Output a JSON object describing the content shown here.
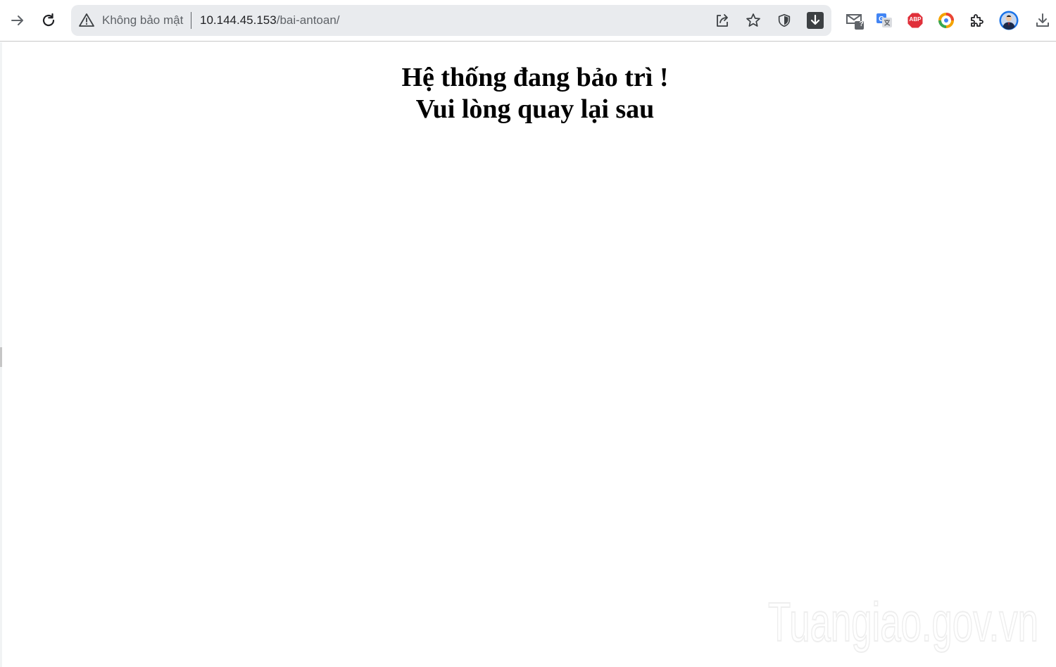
{
  "browser": {
    "omnibox": {
      "security_label": "Không bảo mật",
      "url_host": "10.144.45.153",
      "url_path": "/bai-antoan/"
    },
    "icons": {
      "forward": "arrow-right-icon",
      "reload": "reload-icon",
      "warning": "warning-triangle-icon",
      "share": "share-icon",
      "bookmark": "star-icon",
      "shield": "shield-icon",
      "download_ext": "download-arrow-icon",
      "mail_checker": "mail-icon",
      "translate": "google-translate-icon",
      "adblock": "adblock-plus-icon",
      "colorful_ext": "circle-extension-icon",
      "extensions": "puzzle-icon",
      "profile": "avatar-icon",
      "downloads": "downloads-icon"
    },
    "badges": {
      "mail_badge": "?",
      "adblock_label": "ABP"
    }
  },
  "page": {
    "heading_line1": "Hệ thống đang bảo trì !",
    "heading_line2": "Vui lòng quay lại sau"
  },
  "watermark": {
    "text": "Tuangiao.gov.vn"
  },
  "colors": {
    "omnibox_bg": "#e9ebee",
    "icon_gray": "#5f6368",
    "abp_red": "#e0303a",
    "translate_blue": "#4285f4"
  }
}
